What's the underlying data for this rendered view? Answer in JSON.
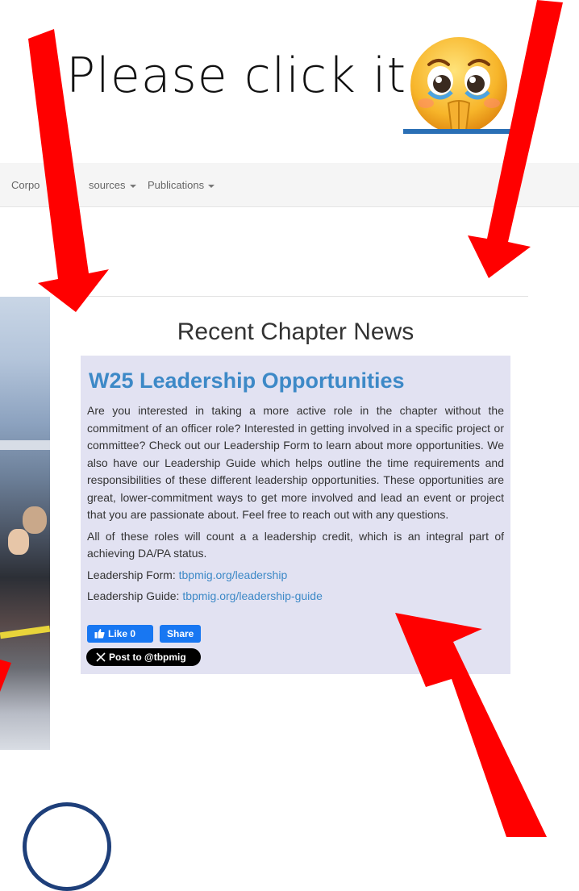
{
  "caption": {
    "text": "Please click it"
  },
  "nav": {
    "items": [
      {
        "label": "Corpo"
      },
      {
        "label": "sources"
      },
      {
        "label": "Publications"
      }
    ]
  },
  "news": {
    "section_title": "Recent Chapter News",
    "article": {
      "title": "W25 Leadership Opportunities",
      "paragraph1": "Are you interested in taking a more active role in the chapter without the commitment of an officer role? Interested in getting involved in a specific project or committee? Check out our Leadership Form to learn about more opportunities. We also have our Leadership Guide which helps outline the time requirements and responsibilities of these different leadership opportunities. These opportunities are great, lower-commitment ways to get more involved and lead an event or project that you are passionate about. Feel free to reach out with any questions.",
      "paragraph2": "All of these roles will count a a leadership credit, which is an integral part of achieving DA/PA status.",
      "form_label": "Leadership Form: ",
      "form_link": "tbpmig.org/leadership",
      "guide_label": "Leadership Guide: ",
      "guide_link": "tbpmig.org/leadership-guide"
    },
    "social": {
      "like_label": "Like 0",
      "share_label": "Share",
      "x_label": "Post to @tbpmig"
    }
  },
  "colors": {
    "arrow": "#ff0000",
    "link": "#3d89c7",
    "card_bg": "#e2e2f2",
    "facebook": "#1877f2"
  },
  "icons": [
    "crying-pleading-emoji-icon",
    "thumbs-up-icon",
    "x-logo-icon",
    "caret-down-icon",
    "red-arrow-icon"
  ]
}
